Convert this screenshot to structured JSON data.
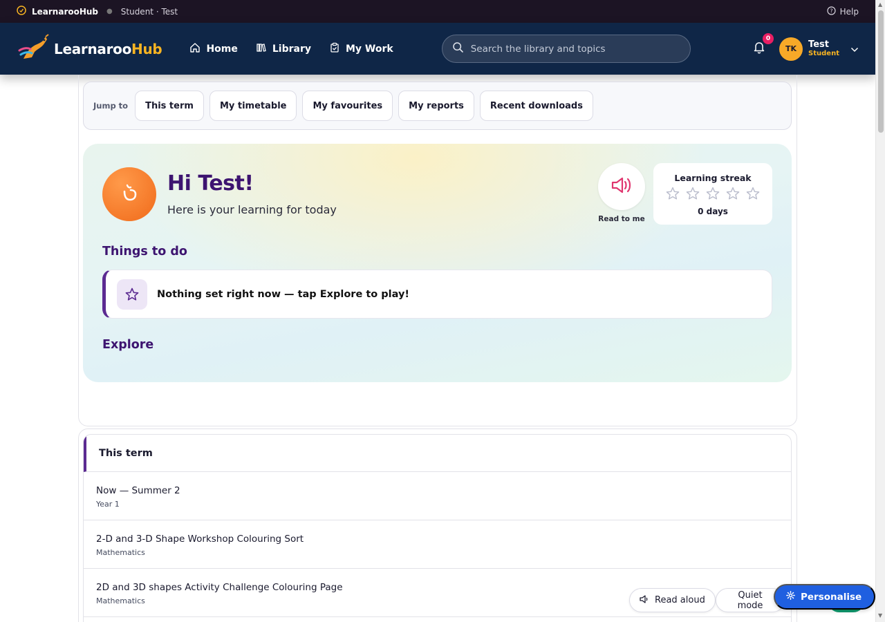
{
  "topbar": {
    "brand": "LearnarooHub",
    "crumb": "Student · Test",
    "help": "Help"
  },
  "navbar": {
    "brand_main": "Learnaroo",
    "brand_accent": "Hub",
    "links": [
      {
        "label": "Home",
        "icon": "home-icon"
      },
      {
        "label": "Library",
        "icon": "library-icon"
      },
      {
        "label": "My Work",
        "icon": "clipboard-icon"
      }
    ],
    "search_placeholder": "Search the library and topics",
    "notifications_count": "0",
    "user": {
      "initials": "TK",
      "name": "Test",
      "role": "Student"
    }
  },
  "jump": {
    "label": "Jump to",
    "chips": [
      "This term",
      "My timetable",
      "My favourites",
      "My reports",
      "Recent downloads"
    ]
  },
  "hero": {
    "title": "Hi Test!",
    "subtitle": "Here is your learning for today",
    "read_label": "Read to me",
    "streak_title": "Learning streak",
    "streak_stars_filled": 0,
    "streak_stars_total": 5,
    "streak_days": "0 days",
    "todo_heading": "Things to do",
    "todo_text": "Nothing set right now — tap Explore to play!",
    "explore_heading": "Explore"
  },
  "term": {
    "heading": "This term",
    "rows": [
      {
        "title": "Now — Summer 2",
        "sub": "Year 1"
      },
      {
        "title": "2-D and 3-D Shape Workshop Colouring Sort",
        "sub": "Mathematics"
      },
      {
        "title": "2D and 3D shapes Activity Challenge Colouring Page",
        "sub": "Mathematics"
      }
    ]
  },
  "floating": {
    "read_aloud": "Read aloud",
    "quiet_mode": "Quiet mode",
    "personalise": "Personalise"
  },
  "colors": {
    "nav_bg": "#0f2647",
    "topbar_bg": "#1c1424",
    "accent_purple": "#3d1470",
    "brand_orange": "#f8b422",
    "personalise_blue": "#1f5fe0"
  }
}
